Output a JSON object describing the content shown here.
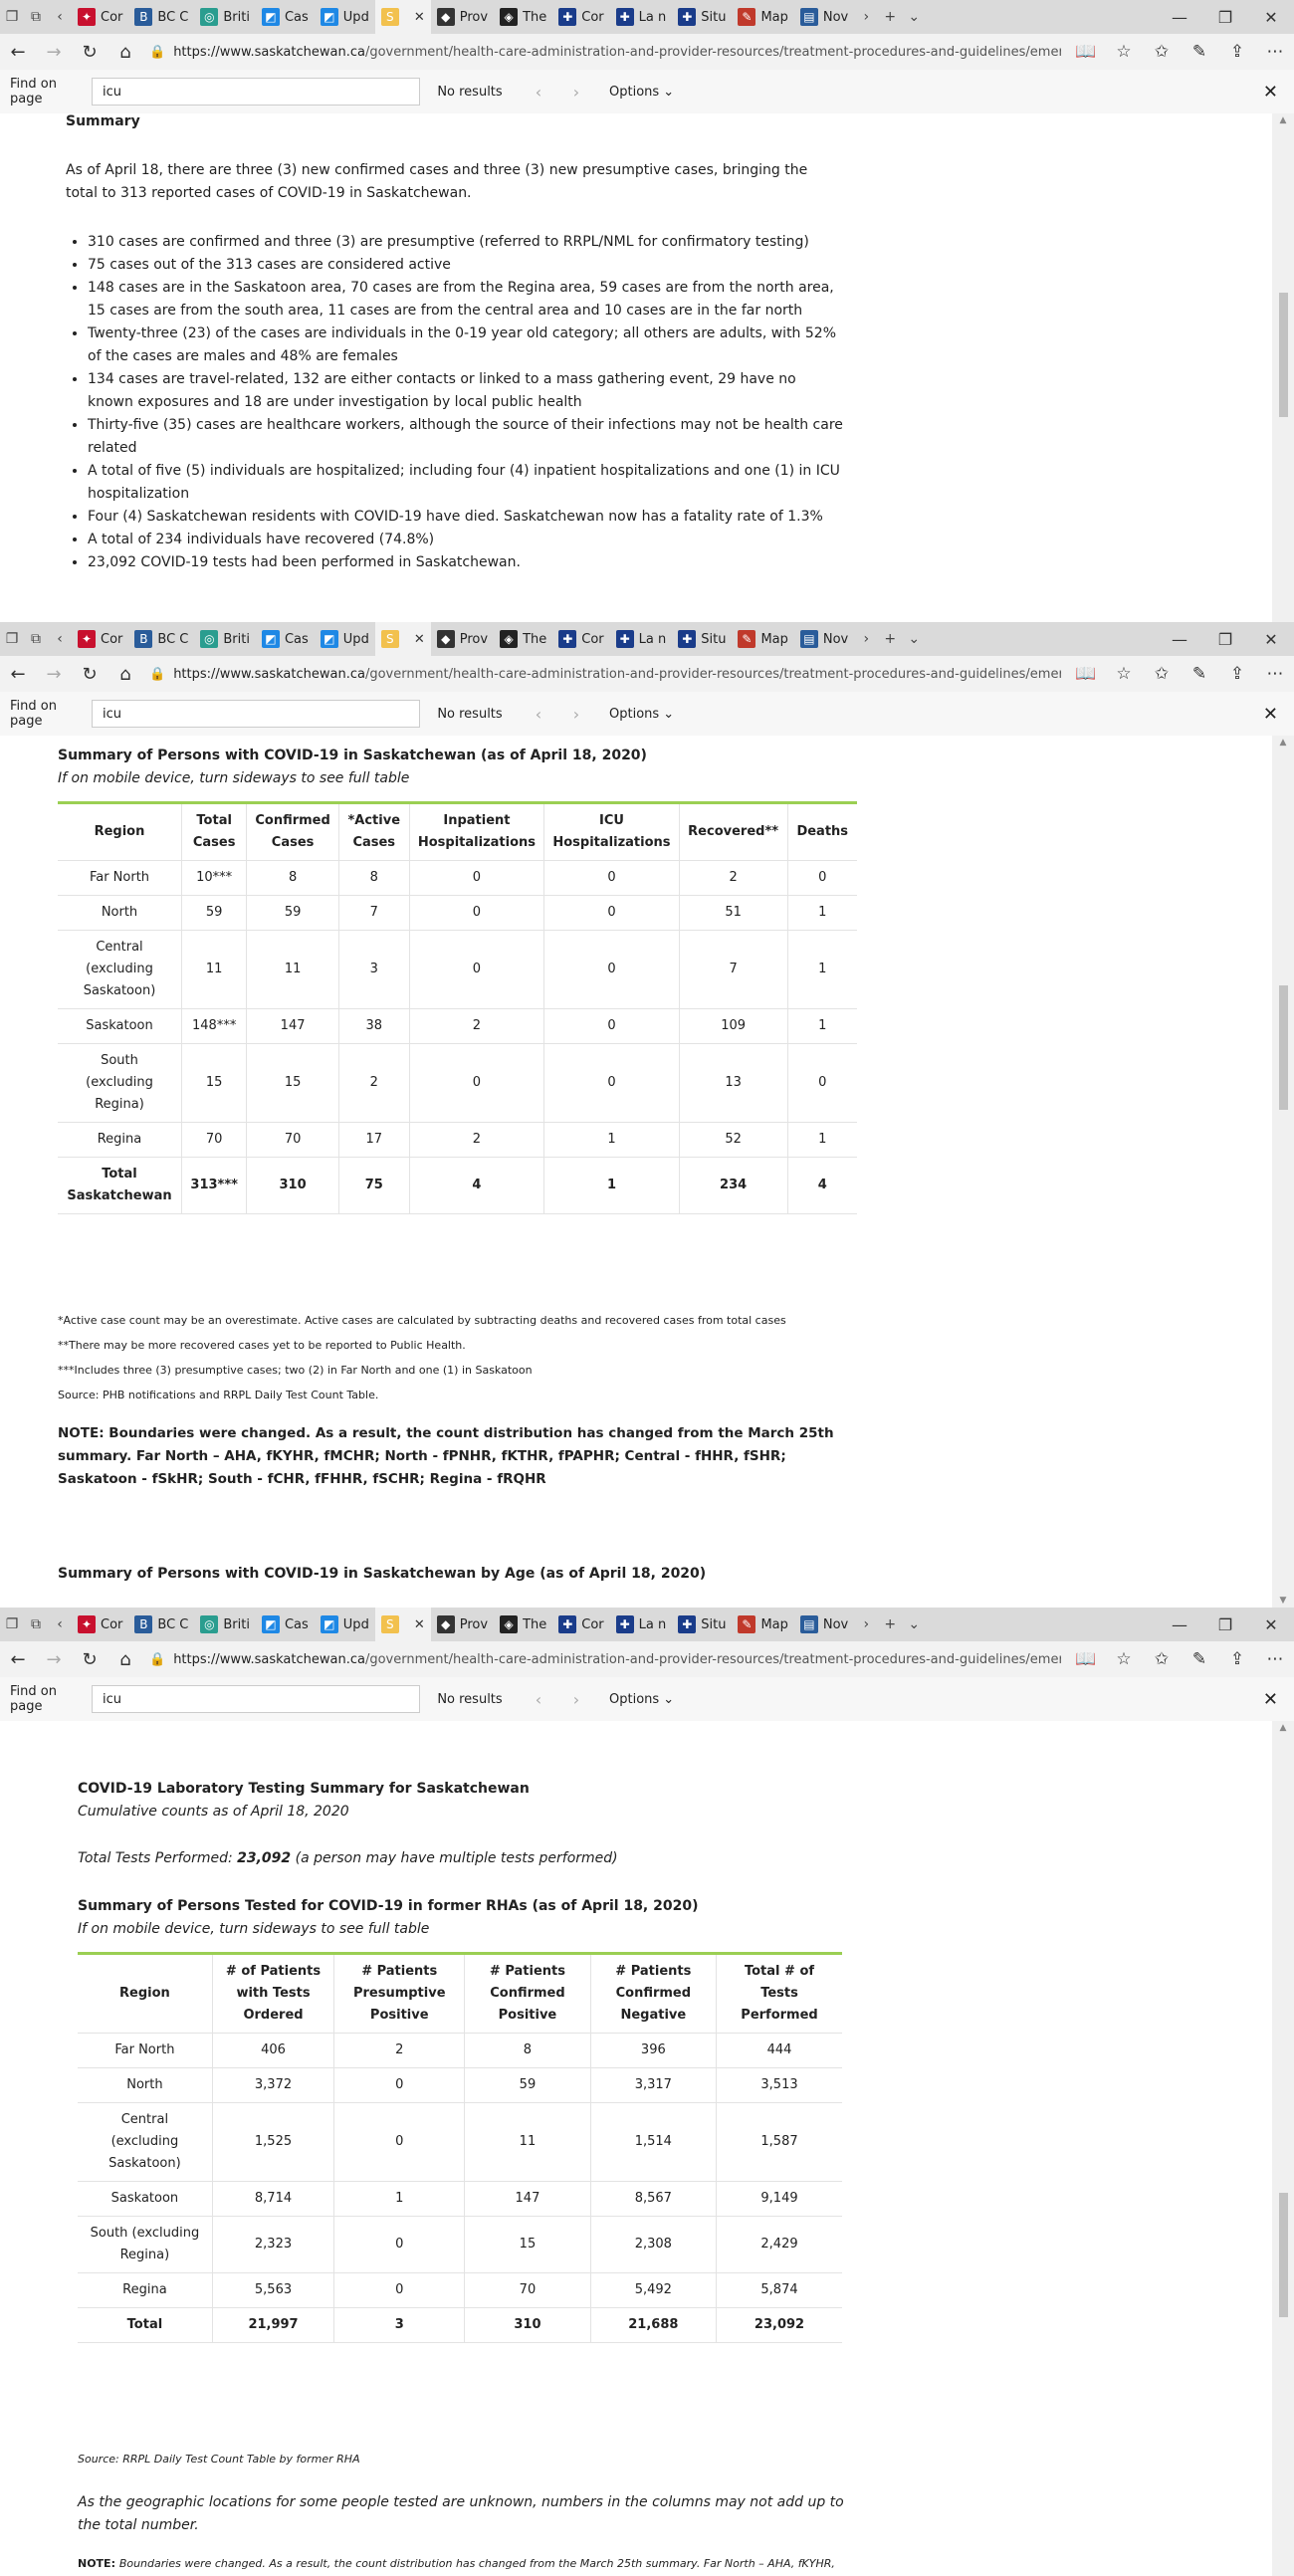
{
  "browser": {
    "tabs": [
      {
        "label": "Cor",
        "color": "#c8102e",
        "icon": "maple-leaf"
      },
      {
        "label": "BC C",
        "color": "#2a5c9a",
        "icon": "bc-logo"
      },
      {
        "label": "Briti",
        "color": "#2a9d8f",
        "icon": "globe"
      },
      {
        "label": "Cas",
        "color": "#1e88e5",
        "icon": "chart"
      },
      {
        "label": "Upd",
        "color": "#1e88e5",
        "icon": "chart"
      },
      {
        "label": "",
        "color": "#f2c14e",
        "icon": "sk-logo",
        "active": true
      },
      {
        "label": "Prov",
        "color": "#333333",
        "icon": "bison"
      },
      {
        "label": "The",
        "color": "#222222",
        "icon": "shield"
      },
      {
        "label": "Cor",
        "color": "#1a3c8a",
        "icon": "quebec"
      },
      {
        "label": "La n",
        "color": "#1a3c8a",
        "icon": "quebec"
      },
      {
        "label": "Situ",
        "color": "#1a3c8a",
        "icon": "quebec"
      },
      {
        "label": "Map",
        "color": "#c0392b",
        "icon": "map"
      },
      {
        "label": "Nov",
        "color": "#2a5c9a",
        "icon": "news"
      }
    ],
    "url_host": "https://www.saskatchewan.ca",
    "url_path": "/government/health-care-administration-and-provider-resources/treatment-procedures-and-guidelines/emerging",
    "find": {
      "label": "Find on page",
      "query": "icu",
      "result": "No results",
      "options": "Options"
    }
  },
  "section1": {
    "title": "Summary",
    "intro": "As of April 18, there are three (3) new confirmed cases and three (3) new presumptive cases, bringing the total to 313 reported cases of COVID-19 in Saskatchewan.",
    "bullets": [
      "310 cases are confirmed and three (3) are presumptive (referred to RRPL/NML for confirmatory testing)",
      "75 cases out of the 313 cases are considered active",
      "148 cases are in the Saskatoon area, 70 cases are from the Regina area, 59 cases are from the north area, 15 cases are from the south area, 11 cases are from the central area and 10 cases are in the far north",
      "Twenty-three (23) of the cases are individuals in the 0-19 year old category; all others are adults, with 52% of the cases are males and 48% are females",
      "134 cases are travel-related, 132 are either contacts or linked to a mass gathering event, 29 have no known exposures and 18 are under investigation by local public health",
      "Thirty-five (35) cases are healthcare workers, although the source of their infections may not be health care related",
      "A total of five (5) individuals are hospitalized; including four (4) inpatient hospitalizations and one (1) in ICU hospitalization",
      "Four (4) Saskatchewan residents with COVID-19 have died. Saskatchewan now has a fatality rate of 1.3%",
      "A total of 234 individuals have recovered (74.8%)",
      "23,092 COVID-19 tests had been performed in Saskatchewan."
    ]
  },
  "section2": {
    "title": "Summary of Persons with COVID-19 in Saskatchewan (as of April 18, 2020)",
    "subtitle": "If on mobile device, turn sideways to see full table",
    "headers": [
      "Region",
      "Total Cases",
      "Confirmed Cases",
      "*Active Cases",
      "Inpatient Hospitalizations",
      "ICU Hospitalizations",
      "Recovered**",
      "Deaths"
    ],
    "rows": [
      [
        "Far North",
        "10***",
        "8",
        "8",
        "0",
        "0",
        "2",
        "0"
      ],
      [
        "North",
        "59",
        "59",
        "7",
        "0",
        "0",
        "51",
        "1"
      ],
      [
        "Central (excluding Saskatoon)",
        "11",
        "11",
        "3",
        "0",
        "0",
        "7",
        "1"
      ],
      [
        "Saskatoon",
        "148***",
        "147",
        "38",
        "2",
        "0",
        "109",
        "1"
      ],
      [
        "South (excluding Regina)",
        "15",
        "15",
        "2",
        "0",
        "0",
        "13",
        "0"
      ],
      [
        "Regina",
        "70",
        "70",
        "17",
        "2",
        "1",
        "52",
        "1"
      ]
    ],
    "total": [
      "Total Saskatchewan",
      "313***",
      "310",
      "75",
      "4",
      "1",
      "234",
      "4"
    ],
    "footnotes": [
      "*Active case count may be an overestimate. Active cases are calculated by subtracting deaths and recovered cases from total cases",
      "**There may be more recovered cases yet to be reported to Public Health.",
      "***Includes three (3) presumptive cases; two (2) in Far North and one (1) in Saskatoon",
      "Source: PHB notifications and RRPL Daily Test Count Table."
    ],
    "note": "NOTE: Boundaries were changed. As a result, the count distribution has changed from the March 25th summary. Far North – AHA, fKYHR, fMCHR; North - fPNHR, fKTHR, fPAPHR; Central - fHHR, fSHR; Saskatoon - fSkHR; South - fCHR, fFHHR, fSCHR; Regina - fRQHR",
    "next_title": "Summary of Persons with COVID-19 in Saskatchewan by Age (as of April 18, 2020)"
  },
  "section3": {
    "title": "COVID-19 Laboratory Testing Summary for Saskatchewan",
    "subtitle": "Cumulative counts as of April 18, 2020",
    "tests_prefix": "Total Tests Performed: ",
    "tests_value": "23,092",
    "tests_suffix": " (a person may have multiple tests performed)",
    "table_title": "Summary of Persons Tested for COVID-19 in former RHAs (as of April 18, 2020)",
    "table_subtitle": "If on mobile device, turn sideways to see full table",
    "headers": [
      "Region",
      "# of Patients with Tests Ordered",
      "# Patients Presumptive Positive",
      "# Patients Confirmed Positive",
      "# Patients Confirmed Negative",
      "Total # of Tests Performed"
    ],
    "rows": [
      [
        "Far North",
        "406",
        "2",
        "8",
        "396",
        "444"
      ],
      [
        "North",
        "3,372",
        "0",
        "59",
        "3,317",
        "3,513"
      ],
      [
        "Central (excluding Saskatoon)",
        "1,525",
        "0",
        "11",
        "1,514",
        "1,587"
      ],
      [
        "Saskatoon",
        "8,714",
        "1",
        "147",
        "8,567",
        "9,149"
      ],
      [
        "South (excluding Regina)",
        "2,323",
        "0",
        "15",
        "2,308",
        "2,429"
      ],
      [
        "Regina",
        "5,563",
        "0",
        "70",
        "5,492",
        "5,874"
      ]
    ],
    "total": [
      "Total",
      "21,997",
      "3",
      "310",
      "21,688",
      "23,092"
    ],
    "source": "Source: RRPL Daily Test Count Table by former RHA",
    "disclaimer": "As the geographic locations for some people tested are unknown, numbers in the columns may not add up to the total number.",
    "note_label": "NOTE: ",
    "note_text": "Boundaries were changed. As a result, the count distribution has changed from the March 25th summary. Far North – AHA, fKYHR,"
  }
}
